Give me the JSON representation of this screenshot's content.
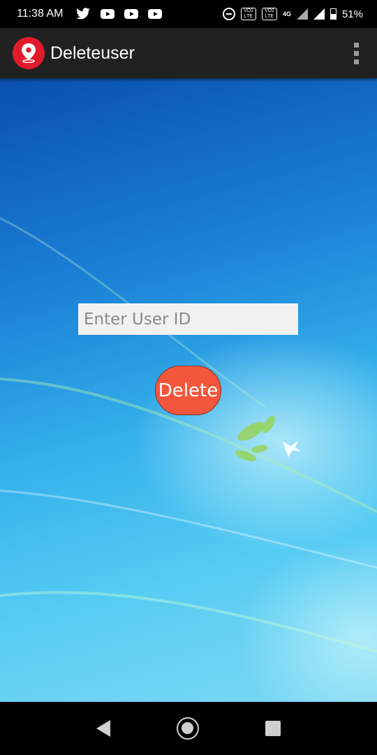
{
  "status_bar": {
    "time": "11:38 AM",
    "notification_icons": [
      "twitter-icon",
      "youtube-icon",
      "youtube-icon",
      "youtube-icon"
    ],
    "network_label": "4G",
    "volte1": "VO1 LTE",
    "volte2": "VO2 LTE",
    "battery_percent": "51%"
  },
  "app_bar": {
    "title": "Deleteuser",
    "icon": "location-pin-icon",
    "brand_color": "#e21b2c"
  },
  "form": {
    "user_id_placeholder": "Enter User ID",
    "user_id_value": "",
    "delete_label": "Delete",
    "delete_color": "#f4563d"
  },
  "nav_bar": {
    "buttons": [
      "back",
      "home",
      "recents"
    ]
  }
}
